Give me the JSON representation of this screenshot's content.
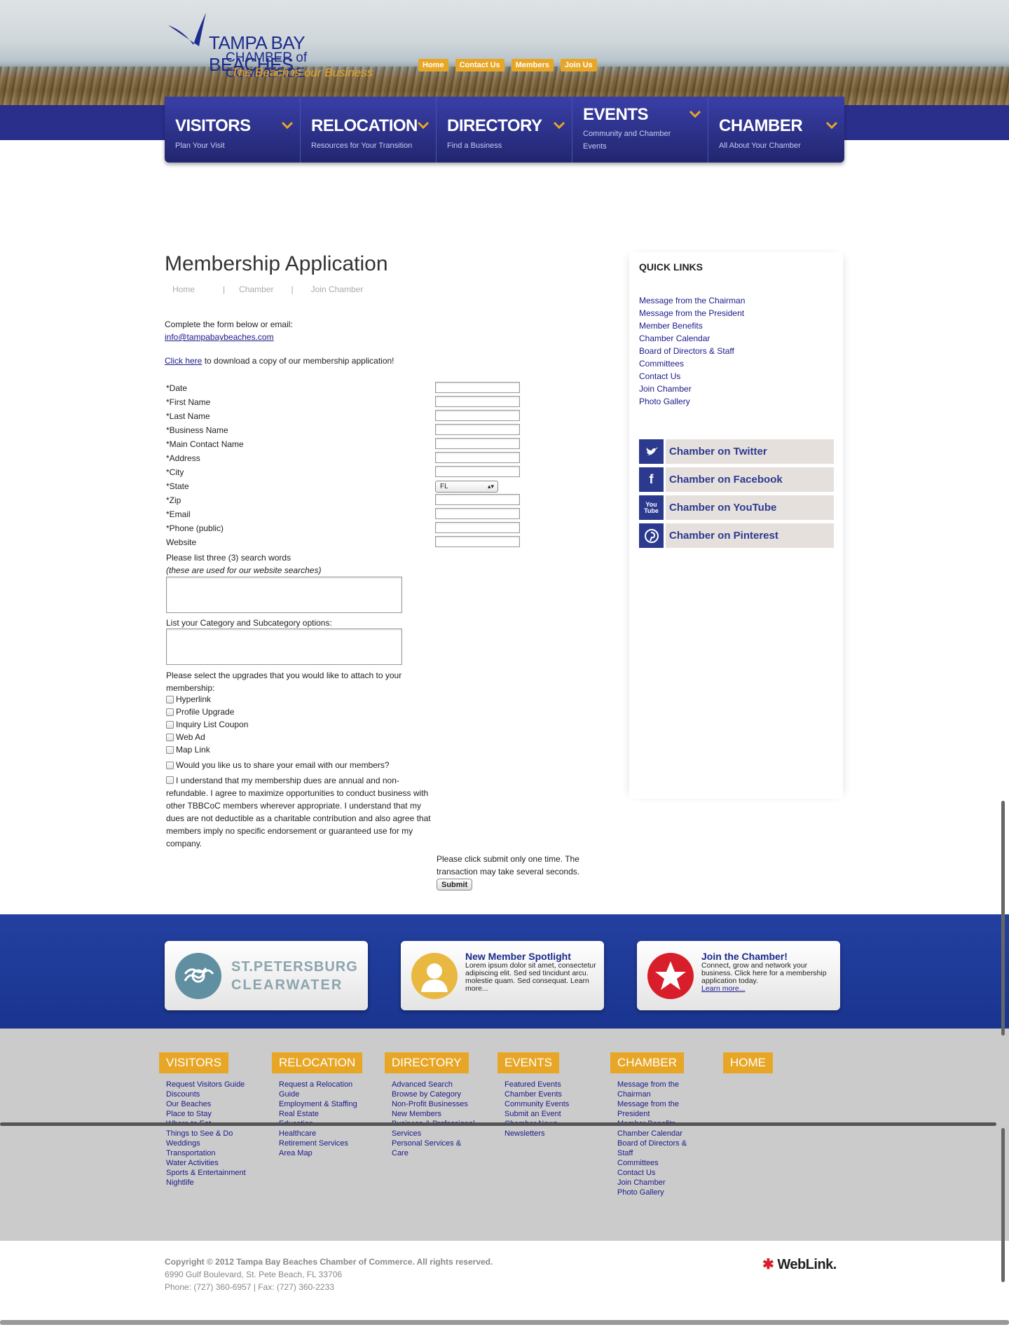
{
  "header": {
    "logo_line1": "TAMPA BAY BEACHES",
    "logo_line2": "CHAMBER of COMMERCE",
    "logo_tagline": "The Beach is our Business",
    "top_links": [
      "Home",
      "Contact Us",
      "Members",
      "Join Us"
    ]
  },
  "main_nav": [
    {
      "label": "VISITORS",
      "sub": "Plan Your Visit"
    },
    {
      "label": "RELOCATION",
      "sub": "Resources for Your Transition"
    },
    {
      "label": "DIRECTORY",
      "sub": "Find a Business"
    },
    {
      "label": "EVENTS",
      "sub": "Community and Chamber Events"
    },
    {
      "label": "CHAMBER",
      "sub": "All About Your Chamber"
    }
  ],
  "page": {
    "title": "Membership Application",
    "breadcrumb": [
      "Home",
      "|",
      "Chamber",
      "|",
      "Join Chamber"
    ],
    "intro_text": "Complete the form below or email:",
    "email": "info@tampabaybeaches.com",
    "download_link": "Click here",
    "download_text": " to download a copy of our membership application!"
  },
  "form": {
    "fields": [
      "*Date",
      "*First Name",
      "*Last Name",
      "*Business Name",
      "*Main Contact Name",
      "*Address",
      "*City",
      "*State",
      "*Zip",
      "*Email",
      "*Phone (public)",
      "Website"
    ],
    "state_value": "FL",
    "search_words_label": "Please list three (3) search words",
    "search_words_note": "(these are used for our website searches)",
    "category_label": "List your Category and Subcategory options:",
    "upgrades_label": "Please select the upgrades that you would like to attach to your membership:",
    "upgrades": [
      "Hyperlink",
      "Profile Upgrade",
      "Inquiry List Coupon",
      "Web Ad",
      "Map Link"
    ],
    "share_email": "Would you like us to share your email with our members?",
    "agreement": "I understand that my membership dues are annual and non-refundable. I agree to maximize opportunities to conduct business with other TBBCoC members wherever appropriate. I understand that my dues are not deductible as a charitable contribution and also agree that members imply no specific endorsement or guaranteed use for my company.",
    "submit_note": "Please click submit only one time.  The transaction may take several seconds.",
    "submit_label": "Submit"
  },
  "sidebar": {
    "title": "QUICK LINKS",
    "links": [
      "Message from the Chairman",
      "Message from the President",
      "Member Benefits",
      "Chamber Calendar",
      "Board of Directors & Staff",
      "Committees",
      "Contact Us",
      "Join Chamber",
      "Photo Gallery"
    ],
    "social": [
      {
        "label": "Chamber on Twitter",
        "icon": "twitter-icon"
      },
      {
        "label": "Chamber on Facebook",
        "icon": "facebook-icon"
      },
      {
        "label": "Chamber on YouTube",
        "icon": "youtube-icon"
      },
      {
        "label": "Chamber on Pinterest",
        "icon": "pinterest-icon"
      }
    ]
  },
  "promo": {
    "card1_line1": "ST.PETERSBURG",
    "card1_line2": "CLEARWATER",
    "card2_title": "New Member Spotlight",
    "card2_text": "Lorem ipsum dolor sit amet, consectetur adipiscing elit. Sed sed tincidunt arcu. molestie quam. Sed consequat. Learn more...",
    "card3_title": "Join the Chamber!",
    "card3_text": "Connect, grow and network your business. Click here for a membership application today.",
    "card3_link": "Learn more..."
  },
  "footer": {
    "columns": [
      {
        "title": "VISITORS",
        "links": [
          "Request Visitors Guide",
          "Discounts",
          "Our Beaches",
          "Place to Stay",
          "Where to Eat",
          "Things to See & Do",
          "Weddings",
          "Transportation",
          "Water Activities",
          "Sports & Entertainment",
          "Nightlife"
        ]
      },
      {
        "title": "RELOCATION",
        "links": [
          "Request a Relocation Guide",
          "Employment & Staffing",
          "Real Estate",
          "Education",
          "Healthcare",
          "Retirement Services",
          "Area Map"
        ]
      },
      {
        "title": "DIRECTORY",
        "links": [
          "Advanced Search",
          "Browse by Category",
          "Non-Profit Businesses",
          "New Members",
          "Business & Professional Services",
          "Personal Services & Care"
        ]
      },
      {
        "title": "EVENTS",
        "links": [
          "Featured Events",
          "Chamber Events",
          "Community Events",
          "Submit an Event",
          "Chamber News",
          "Newsletters"
        ]
      },
      {
        "title": "CHAMBER",
        "links": [
          "Message from the Chairman",
          "Message from the President",
          "Member Benefits",
          "Chamber Calendar",
          "Board of Directors & Staff",
          "Committees",
          "Contact Us",
          "Join Chamber",
          "Photo Gallery"
        ]
      },
      {
        "title": "HOME",
        "links": []
      }
    ],
    "copyright": "Copyright © 2012 Tampa Bay Beaches Chamber of Commerce.  All rights reserved.",
    "address": "6990 Gulf Boulevard, St. Pete Beach, FL 33706",
    "phone": "Phone: (727) 360-6957 | Fax: (727) 360-2233",
    "weblink": "WebLink."
  }
}
